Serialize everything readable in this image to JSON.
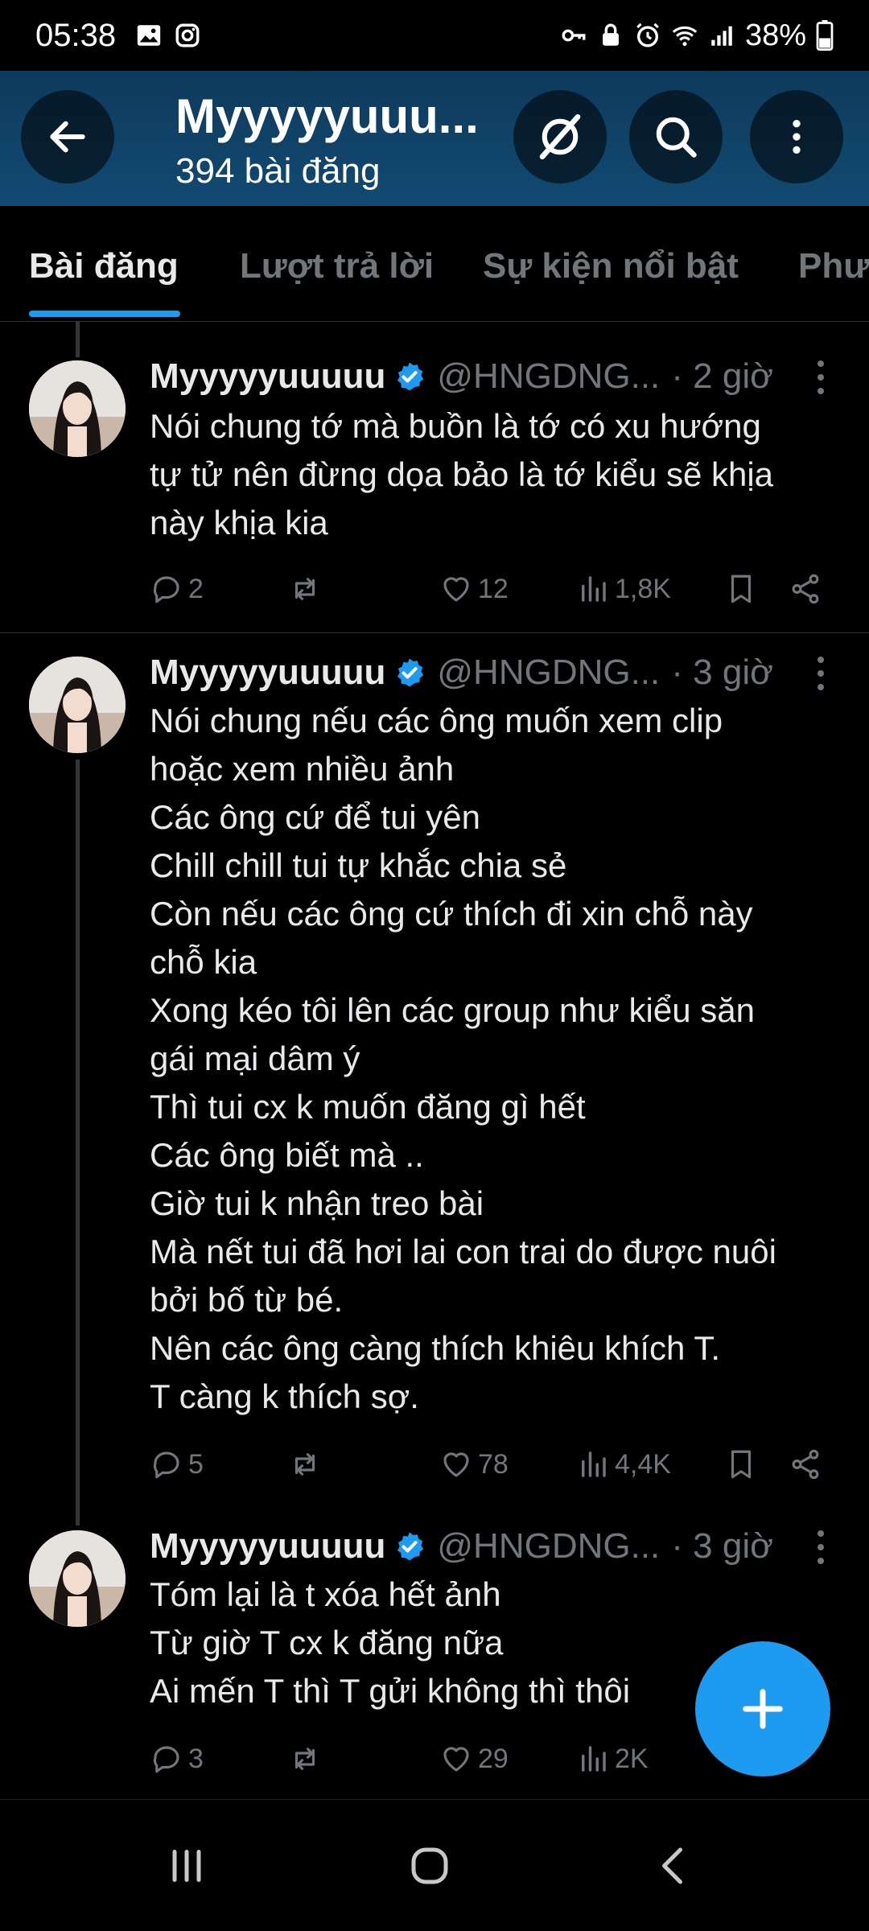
{
  "status_bar": {
    "time": "05:38",
    "left_icons": [
      "gallery-icon",
      "instagram-icon"
    ],
    "right_icons": [
      "key-icon",
      "lock-icon",
      "alarm-icon",
      "wifi-icon",
      "signal-icon"
    ],
    "battery": "38%"
  },
  "header": {
    "title": "Myyyyyuuu...",
    "subtitle": "394 bài đăng",
    "buttons": [
      "back-icon",
      "no-image-icon",
      "search-icon",
      "more-icon"
    ]
  },
  "tabs": [
    {
      "label": "Bài đăng",
      "active": true
    },
    {
      "label": "Lượt trả lời",
      "active": false
    },
    {
      "label": "Sự kiện nổi bật",
      "active": false
    },
    {
      "label": "Phư",
      "active": false
    }
  ],
  "posts": [
    {
      "name": "Myyyyyuuuuu",
      "handle": "@HNGDNG...",
      "time": "· 2 giờ",
      "lines": [
        "Nói chung tớ mà buồn là tớ có xu hướng",
        "tự tử nên đừng dọa bảo là tớ kiểu sẽ khịa",
        "này khịa kia"
      ],
      "replies": "2",
      "reposts": "",
      "likes": "12",
      "views": "1,8K"
    },
    {
      "name": "Myyyyyuuuuu",
      "handle": "@HNGDNG...",
      "time": "· 3 giờ",
      "lines": [
        "Nói chung nếu các ông muốn xem clip",
        "hoặc xem nhiều ảnh",
        "Các ông cứ để tui yên",
        "Chill chill tui tự khắc chia sẻ",
        "Còn nếu các ông cứ thích đi xin chỗ này",
        "chỗ kia",
        "Xong kéo tôi lên các group như kiểu săn",
        "gái mại dâm ý",
        "Thì tui cx k muốn đăng gì hết",
        "Các ông biết mà ..",
        "Giờ tui k nhận treo bài",
        "Mà nết tui đã hơi lai con trai do được nuôi",
        "bởi bố từ bé.",
        "Nên các ông càng thích khiêu khích T.",
        "T càng k thích sợ."
      ],
      "replies": "5",
      "reposts": "",
      "likes": "78",
      "views": "4,4K"
    },
    {
      "name": "Myyyyyuuuuu",
      "handle": "@HNGDNG...",
      "time": "· 3 giờ",
      "lines": [
        "Tóm lại là t xóa hết ảnh",
        "Từ giờ T cx k đăng nữa",
        "Ai mến T thì T gửi không thì thôi"
      ],
      "replies": "3",
      "reposts": "",
      "likes": "29",
      "views": "2K"
    }
  ],
  "fab": {
    "icon": "plus-icon"
  },
  "navbar": {
    "buttons": [
      "recent-apps-icon",
      "home-icon",
      "back-nav-icon"
    ]
  },
  "colors": {
    "accent": "#1d9bf0",
    "header_bg": "#124a72",
    "muted": "#71767b",
    "text": "#e7e9ea",
    "background": "#000000"
  }
}
